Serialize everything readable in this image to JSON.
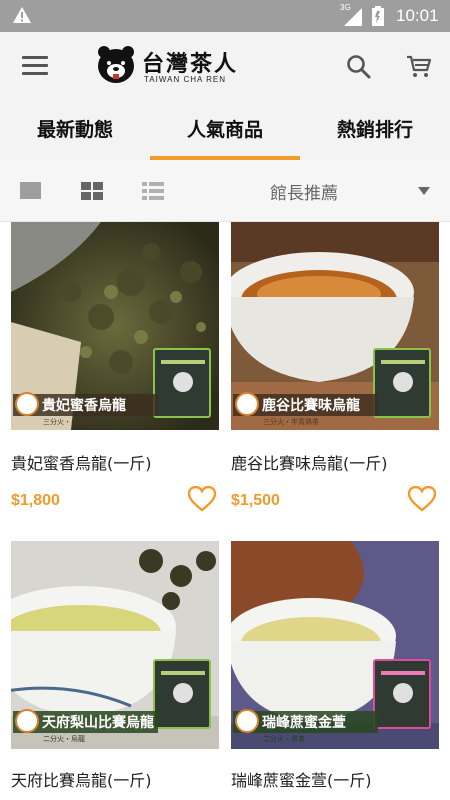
{
  "status_bar": {
    "time": "10:01",
    "network": "3G"
  },
  "app_bar": {
    "logo_title": "台灣茶人",
    "logo_subtitle": "TAIWAN CHA REN"
  },
  "tabs": [
    {
      "label": "最新動態",
      "active": false
    },
    {
      "label": "人氣商品",
      "active": true
    },
    {
      "label": "熱銷排行",
      "active": false
    }
  ],
  "view_bar": {
    "sort_label": "館長推薦"
  },
  "colors": {
    "accent": "#f39a2b",
    "appbar_bg": "#f3f3f3",
    "status_bar_bg": "#9e9e9e"
  },
  "products": [
    {
      "name": "貴妃蜜香烏龍(一斤)",
      "price": "$1,800",
      "banner_label": "貴妃蜜香烏龍",
      "banner_tag": "三分火・半青熟茶"
    },
    {
      "name": "鹿谷比賽味烏龍(一斤)",
      "price": "$1,500",
      "banner_label": "鹿谷比賽味烏龍",
      "banner_tag": "三分火・半青熟茶"
    },
    {
      "name": "天府比賽烏龍(一斤)",
      "price": "",
      "banner_label": "天府梨山比賽烏龍",
      "banner_tag": "二分火・烏龍"
    },
    {
      "name": "瑞峰蔗蜜金萱(一斤)",
      "price": "",
      "banner_label": "瑞峰蔗蜜金萱",
      "banner_tag": "二分火・青茶"
    }
  ]
}
